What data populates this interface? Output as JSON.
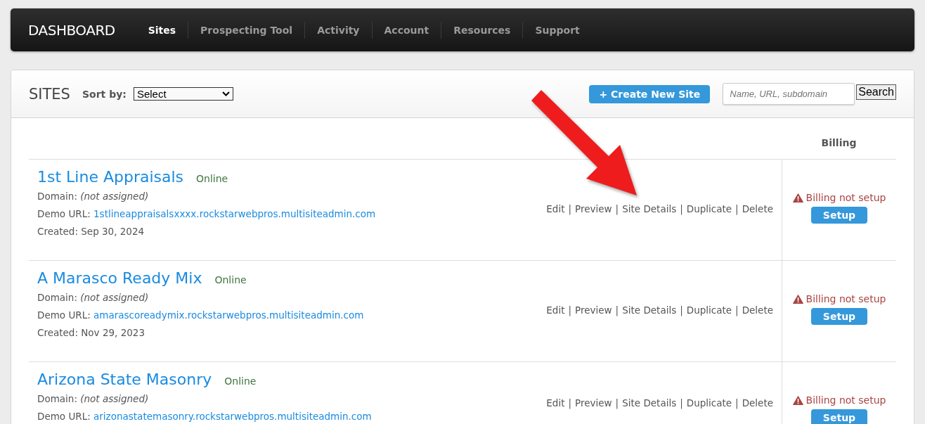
{
  "nav": {
    "brand": "DASHBOARD",
    "items": [
      {
        "label": "Sites",
        "selected": true
      },
      {
        "label": "Prospecting Tool",
        "selected": false
      },
      {
        "label": "Activity",
        "selected": false
      },
      {
        "label": "Account",
        "selected": false
      },
      {
        "label": "Resources",
        "selected": false
      },
      {
        "label": "Support",
        "selected": false
      }
    ]
  },
  "sites_panel": {
    "title": "SITES",
    "sort_label": "Sort by:",
    "sort_value": "Select",
    "create_button": "+ Create New Site",
    "search": {
      "placeholder": "Name, URL, subdomain"
    },
    "search_button": "Search",
    "column_header": "Billing"
  },
  "sites": [
    {
      "name": "1st Line Appraisals",
      "status": "Online",
      "domain_label": "Domain:",
      "domain": "(not assigned)",
      "demo_label": "Demo URL:",
      "demo_url": "1stlineappraisalsxxxx.rockstarwebpros.multisiteadmin.com",
      "created": "Created: Sep 30, 2024",
      "actions": [
        "Edit",
        "Preview",
        "Site Details",
        "Duplicate",
        "Delete"
      ],
      "separator": "|",
      "billing_status": "Billing not setup",
      "billing_button": "Setup"
    },
    {
      "name": "A Marasco Ready Mix",
      "status": "Online",
      "domain_label": "Domain:",
      "domain": "(not assigned)",
      "demo_label": "Demo URL:",
      "demo_url": "amarascoreadymix.rockstarwebpros.multisiteadmin.com",
      "created": "Created: Nov 29, 2023",
      "actions": [
        "Edit",
        "Preview",
        "Site Details",
        "Duplicate",
        "Delete"
      ],
      "separator": "|",
      "billing_status": "Billing not setup",
      "billing_button": "Setup"
    },
    {
      "name": "Arizona State Masonry",
      "status": "Online",
      "domain_label": "Domain:",
      "domain": "(not assigned)",
      "demo_label": "Demo URL:",
      "demo_url": "arizonastatemasonry.rockstarwebpros.multisiteadmin.com",
      "actions": [
        "Edit",
        "Preview",
        "Site Details",
        "Duplicate",
        "Delete"
      ],
      "separator": "|",
      "billing_status": "Billing not setup",
      "billing_button": "Setup"
    }
  ]
}
